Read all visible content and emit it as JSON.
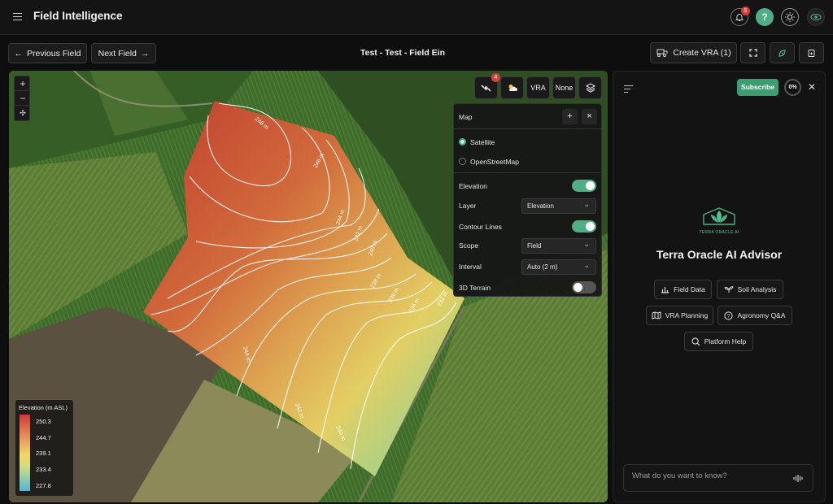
{
  "app": {
    "title": "Field Intelligence",
    "notification_count": "5",
    "help_label": "?"
  },
  "nav": {
    "prev_label": "Previous Field",
    "next_label": "Next Field",
    "field_title": "Test - Test - Field Ein"
  },
  "toolbar": {
    "create_vra_label": "Create VRA (1)"
  },
  "map": {
    "tools": {
      "satellite_badge": "4",
      "vra_label": "VRA",
      "none_label": "None"
    },
    "panel": {
      "title": "Map",
      "base_options": [
        "Satellite",
        "OpenStreetMap"
      ],
      "selected_base": "Satellite",
      "elevation_label": "Elevation",
      "elevation_on": true,
      "layer_label": "Layer",
      "layer_value": "Elevation",
      "contour_label": "Contour Lines",
      "contour_on": true,
      "scope_label": "Scope",
      "scope_value": "Field",
      "interval_label": "Interval",
      "interval_value": "Auto (2 m)",
      "terrain_label": "3D Terrain",
      "terrain_on": false
    },
    "contour_labels": [
      "248 m",
      "246 m",
      "244 m",
      "242 m",
      "240 m",
      "238 m",
      "236 m",
      "234 m",
      "232 m",
      "244 m",
      "242 m",
      "240 m"
    ],
    "legend": {
      "title": "Elevation (m ASL)",
      "ticks": [
        "250.3",
        "244.7",
        "239.1",
        "233.4",
        "227.8"
      ]
    }
  },
  "advisor": {
    "subscribe_label": "Subscribe",
    "usage": "0%",
    "logo_text": "TERRA ORACLE AI",
    "title": "Terra Oracle AI Advisor",
    "chips": [
      "Field Data",
      "Soil Analysis",
      "VRA Planning",
      "Agronomy Q&A",
      "Platform Help"
    ],
    "ask_placeholder": "What do you want to know?"
  },
  "colors": {
    "accent": "#4fae84",
    "badge": "#d6403a",
    "background": "#0e0e0e"
  }
}
